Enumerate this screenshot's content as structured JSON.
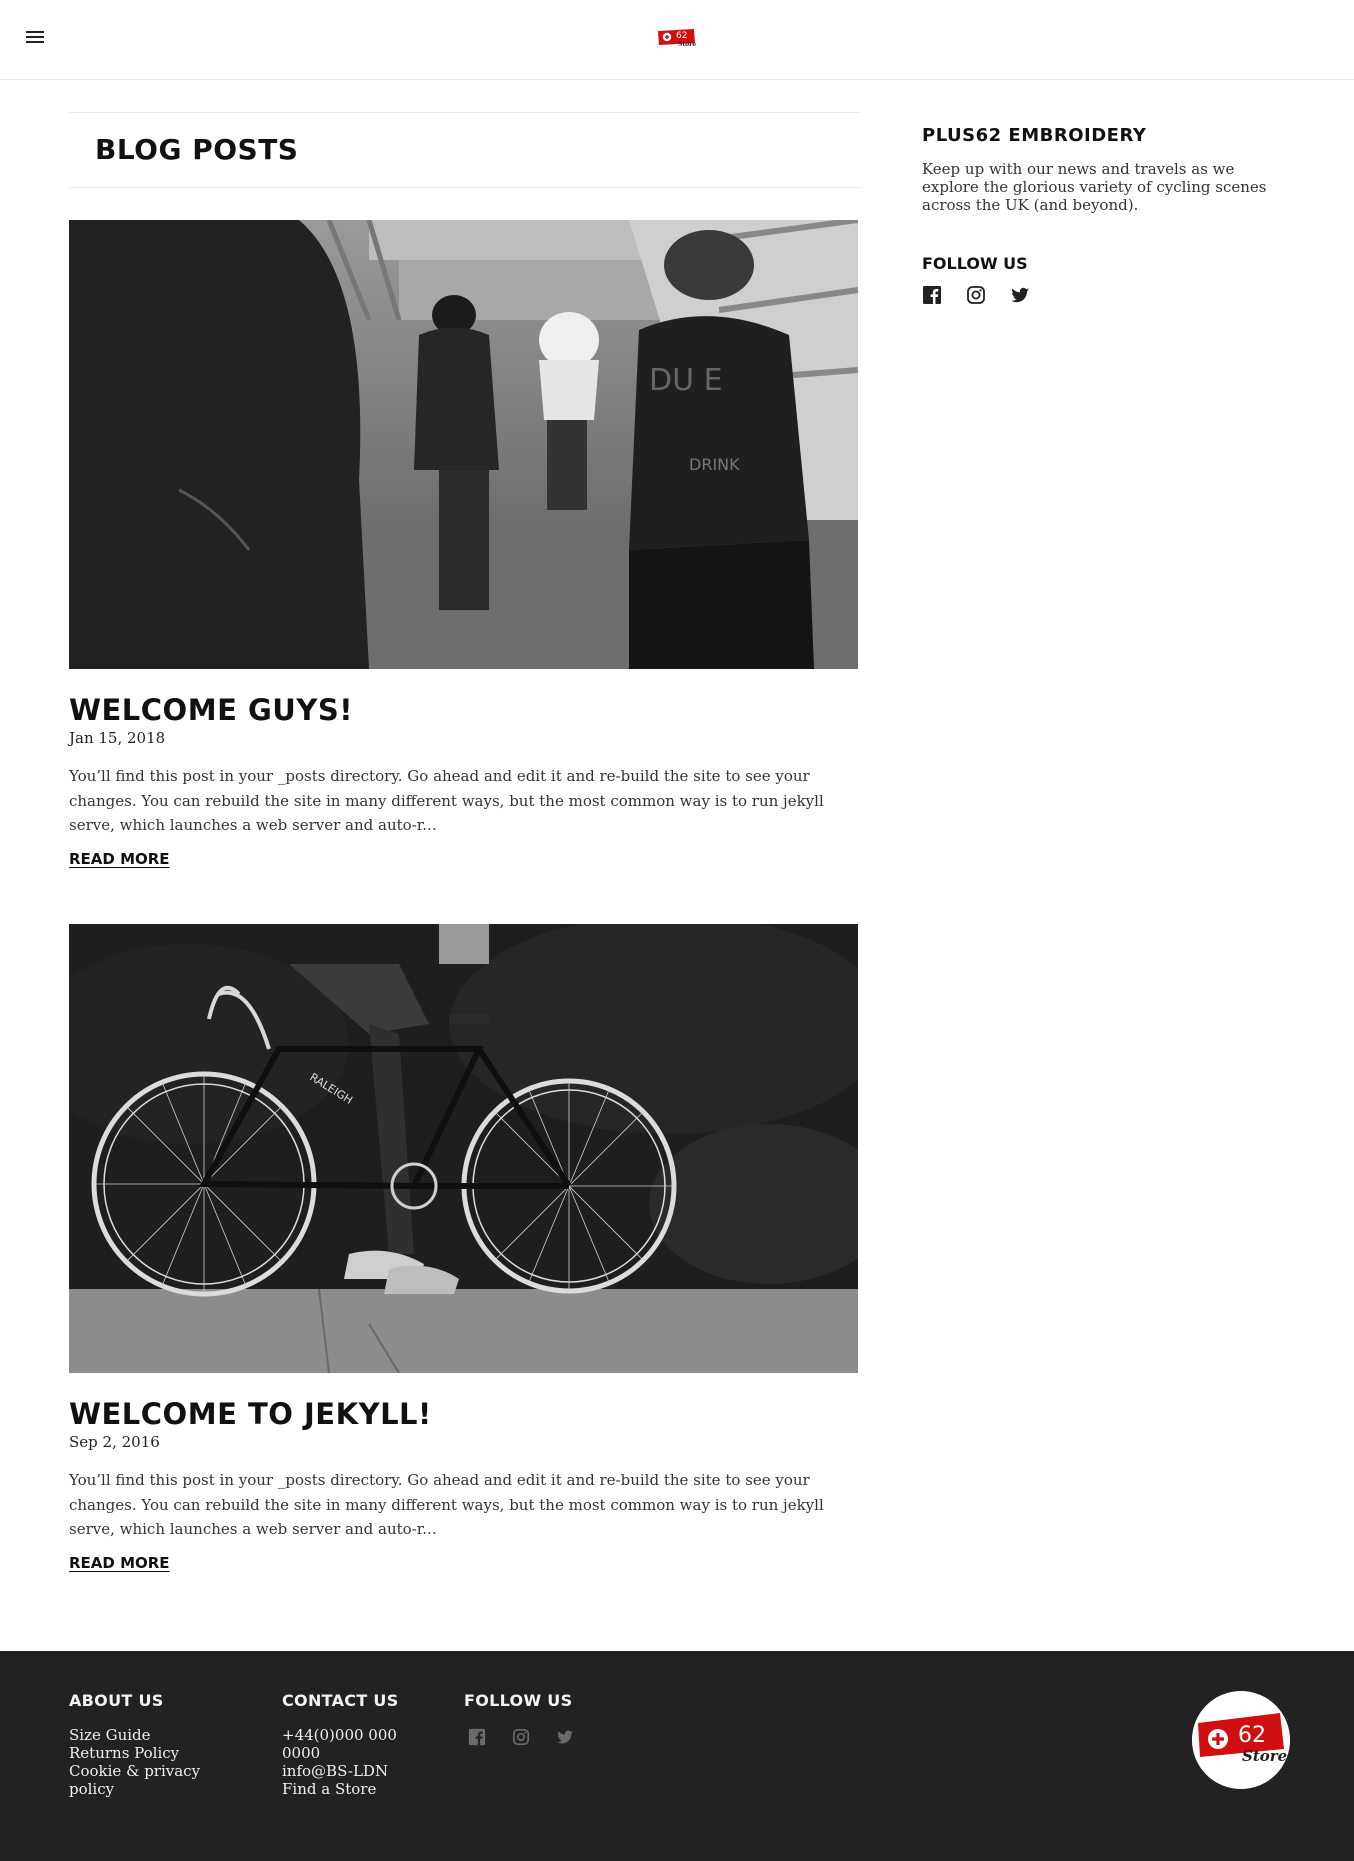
{
  "header": {
    "menu_icon": "hamburger-menu-icon",
    "logo_alt": "+62 Store"
  },
  "main": {
    "section_title": "BLOG POSTS",
    "posts": [
      {
        "title": "WELCOME GUYS!",
        "date": "Jan 15, 2018",
        "excerpt": "You’ll find this post in your _posts directory. Go ahead and edit it and re-build the site to see your changes. You can rebuild the site in many different ways, but the most common way is to run jekyll serve, which launches a web server and auto-r...",
        "read_more": "READ MORE"
      },
      {
        "title": "WELCOME TO JEKYLL!",
        "date": "Sep 2, 2016",
        "excerpt": "You’ll find this post in your _posts directory. Go ahead and edit it and re-build the site to see your changes. You can rebuild the site in many different ways, but the most common way is to run jekyll serve, which launches a web server and auto-r...",
        "read_more": "READ MORE"
      }
    ]
  },
  "sidebar": {
    "title": "PLUS62 EMBROIDERY",
    "description": "Keep up with our news and travels as we explore the glorious variety of cycling scenes across the UK (and beyond).",
    "follow_title": "FOLLOW US",
    "social_icons": [
      "facebook-icon",
      "instagram-icon",
      "twitter-icon"
    ]
  },
  "footer": {
    "about": {
      "title": "ABOUT US",
      "links": [
        "Size Guide",
        "Returns Policy",
        "Cookie & privacy policy"
      ]
    },
    "contact": {
      "title": "CONTACT US",
      "phone": "+44(0)000 000 0000",
      "email": "info@BS-LDN",
      "store": "Find a Store"
    },
    "follow": {
      "title": "FOLLOW US"
    }
  },
  "colors": {
    "brand_red": "#d01010",
    "footer_bg": "#222222",
    "text": "#222222"
  }
}
